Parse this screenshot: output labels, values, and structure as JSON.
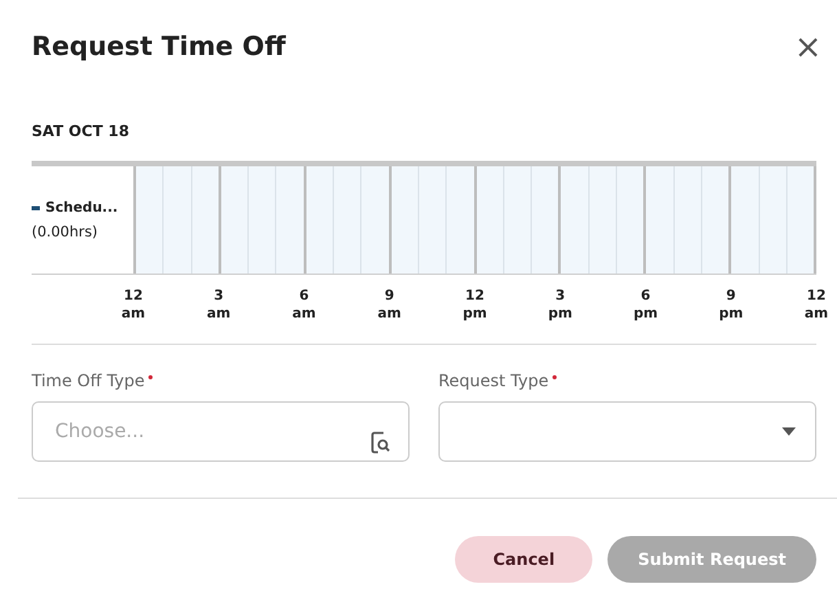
{
  "dialog": {
    "title": "Request Time Off",
    "close": "×"
  },
  "schedule": {
    "date": "SAT OCT 18",
    "row_label": "Schedu...",
    "hours": "(0.00hrs)",
    "ticks": [
      {
        "hour": "12",
        "period": "am"
      },
      {
        "hour": "3",
        "period": "am"
      },
      {
        "hour": "6",
        "period": "am"
      },
      {
        "hour": "9",
        "period": "am"
      },
      {
        "hour": "12",
        "period": "pm"
      },
      {
        "hour": "3",
        "period": "pm"
      },
      {
        "hour": "6",
        "period": "pm"
      },
      {
        "hour": "9",
        "period": "pm"
      },
      {
        "hour": "12",
        "period": "am"
      }
    ]
  },
  "fields": [
    {
      "kind": "search",
      "label": "Time Off Type",
      "required": true,
      "placeholder": "Choose..."
    },
    {
      "kind": "select",
      "label": "Request Type",
      "required": true
    }
  ],
  "buttons": [
    {
      "label": "Cancel",
      "kind": "secondary",
      "disabled": false
    },
    {
      "label": "Submit Request",
      "kind": "primary",
      "disabled": true
    }
  ]
}
